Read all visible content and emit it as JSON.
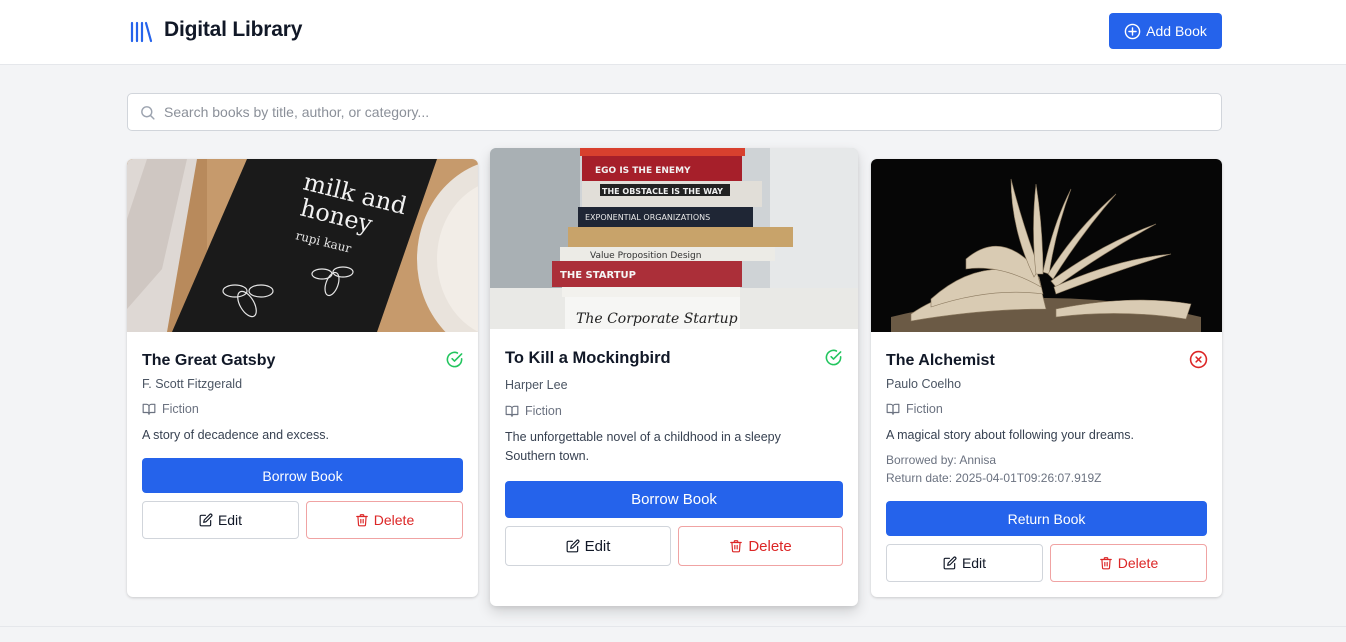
{
  "header": {
    "brand": "Digital Library",
    "add_button_label": "Add Book"
  },
  "search": {
    "placeholder": "Search books by title, author, or category..."
  },
  "colors": {
    "primary": "#2563eb",
    "available": "#22c55e",
    "unavailable": "#dc2626"
  },
  "books": [
    {
      "title": "The Great Gatsby",
      "author": "F. Scott Fitzgerald",
      "category": "Fiction",
      "description": "A story of decadence and excess.",
      "status_icon": "check-circle-icon",
      "primary_action": "Borrow Book",
      "edit_label": "Edit",
      "delete_label": "Delete",
      "cover_text": "milk and honey",
      "cover_author": "rupi kaur"
    },
    {
      "title": "To Kill a Mockingbird",
      "author": "Harper Lee",
      "category": "Fiction",
      "description": "The unforgettable novel of a childhood in a sleepy Southern town.",
      "status_icon": "check-circle-icon",
      "primary_action": "Borrow Book",
      "edit_label": "Edit",
      "delete_label": "Delete",
      "spines": [
        "EGO IS THE ENEMY",
        "THE OBSTACLE IS THE WAY",
        "EXPONENTIAL ORGANIZATIONS",
        "Value Proposition Design",
        "THE STARTUP OWNER'S MANUAL",
        "The Corporate Startup"
      ]
    },
    {
      "title": "The Alchemist",
      "author": "Paulo Coelho",
      "category": "Fiction",
      "description": "A magical story about following your dreams.",
      "status_icon": "x-circle-icon",
      "borrowed_by": "Borrowed by: Annisa",
      "return_date": "Return date: 2025-04-01T09:26:07.919Z",
      "primary_action": "Return Book",
      "edit_label": "Edit",
      "delete_label": "Delete"
    }
  ]
}
